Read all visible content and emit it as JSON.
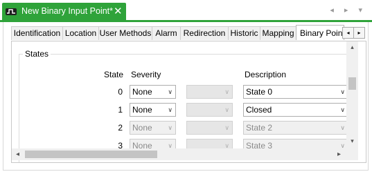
{
  "editor_tab": {
    "title": "New Binary Input Point*",
    "close_glyph": "✕",
    "icon": "binary-input-icon",
    "nav_arrows": "◂ ▸ ▾"
  },
  "property_tabs": [
    {
      "label": "Identification"
    },
    {
      "label": "Location"
    },
    {
      "label": "User Methods"
    },
    {
      "label": "Alarm"
    },
    {
      "label": "Redirection"
    },
    {
      "label": "Historic"
    },
    {
      "label": "Mapping"
    },
    {
      "label": "Binary Point"
    }
  ],
  "tab_scroll": {
    "left": "◂",
    "right": "▸"
  },
  "states_group": {
    "title": "States",
    "headers": {
      "state": "State",
      "severity": "Severity",
      "description": "Description"
    },
    "rows": [
      {
        "state": "0",
        "severity": "None",
        "description": "State 0",
        "enabled": true
      },
      {
        "state": "1",
        "severity": "None",
        "description": "Closed",
        "enabled": true
      },
      {
        "state": "2",
        "severity": "None",
        "description": "State 2",
        "enabled": false
      },
      {
        "state": "3",
        "severity": "None",
        "description": "State 3",
        "enabled": false
      }
    ]
  },
  "scroll": {
    "up": "▴",
    "down": "▾",
    "left": "◂",
    "right": "▸"
  },
  "colors": {
    "accent": "#2fa33a"
  }
}
